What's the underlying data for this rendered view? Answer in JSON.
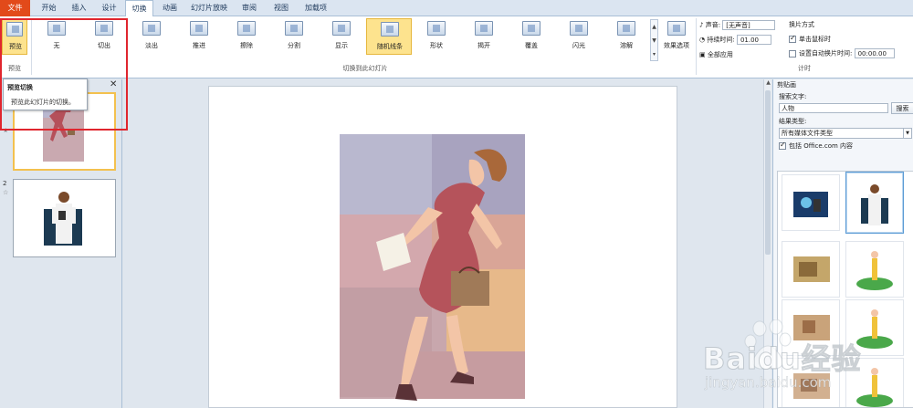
{
  "tabs": [
    {
      "label": "文件"
    },
    {
      "label": "开始"
    },
    {
      "label": "插入"
    },
    {
      "label": "设计"
    },
    {
      "label": "切换"
    },
    {
      "label": "动画"
    },
    {
      "label": "幻灯片放映"
    },
    {
      "label": "审阅"
    },
    {
      "label": "视图"
    },
    {
      "label": "加载项"
    }
  ],
  "ribbon": {
    "preview_label": "预览",
    "preview_group": "预览",
    "transitions": [
      {
        "label": "无"
      },
      {
        "label": "切出"
      },
      {
        "label": "淡出"
      },
      {
        "label": "推进"
      },
      {
        "label": "擦除"
      },
      {
        "label": "分割"
      },
      {
        "label": "显示"
      },
      {
        "label": "随机线条"
      },
      {
        "label": "形状"
      },
      {
        "label": "揭开"
      },
      {
        "label": "覆盖"
      },
      {
        "label": "闪光"
      },
      {
        "label": "溶解"
      }
    ],
    "transitions_group": "切换到此幻灯片",
    "effect_options": "效果选项",
    "sound_label": "声音:",
    "sound_value": "[无声音]",
    "duration_label": "持续时间:",
    "duration_value": "01.00",
    "apply_all": "全部应用",
    "advance_title": "换片方式",
    "on_click": "单击鼠标时",
    "after_label": "设置自动换片时间:",
    "after_value": "00:00.00",
    "timing_group": "计时"
  },
  "tooltip": {
    "title": "预览切换",
    "desc": "预览此幻灯片的切换。"
  },
  "thumbnails": {
    "slide2_num": "2"
  },
  "clipart": {
    "title": "剪贴画",
    "search_label": "搜索文字:",
    "search_value": "人物",
    "search_button": "搜索",
    "result_type_label": "结果类型:",
    "result_type_value": "所有媒体文件类型",
    "include_office": "包括 Office.com 内容"
  },
  "watermark": {
    "brand": "Baidu经验",
    "url": "jingyan.baidu.com"
  },
  "colors": {
    "file_tab": "#e24a1a",
    "selected_transition": "#fde38e",
    "highlight_box": "#e0262e"
  }
}
